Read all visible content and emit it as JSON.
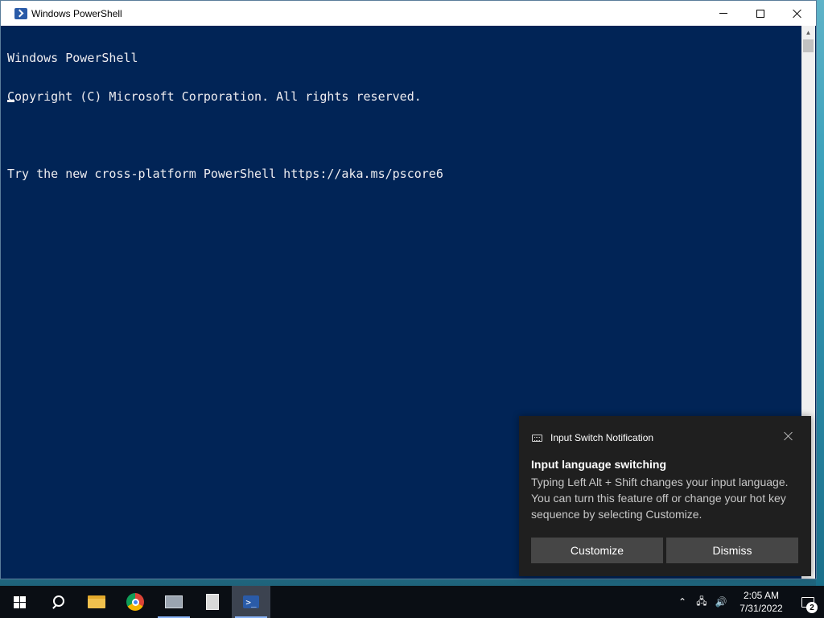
{
  "window": {
    "title": "Windows PowerShell"
  },
  "console": {
    "lines": [
      "Windows PowerShell",
      "Copyright (C) Microsoft Corporation. All rights reserved.",
      "",
      "Try the new cross-platform PowerShell https://aka.ms/pscore6"
    ]
  },
  "toast": {
    "app_name": "Input Switch Notification",
    "title": "Input language switching",
    "body": "Typing Left Alt + Shift changes your input language. You can turn this feature off or change your hot key sequence by selecting Customize.",
    "customize_label": "Customize",
    "dismiss_label": "Dismiss"
  },
  "taskbar": {
    "time": "2:05 AM",
    "date": "7/31/2022",
    "notification_count": "2",
    "pinned": [
      "start-icon",
      "search-icon",
      "file-explorer-icon",
      "chrome-icon",
      "server-manager-icon",
      "document-icon",
      "powershell-icon"
    ]
  },
  "colors": {
    "console_bg": "#012456",
    "console_fg": "#eeedf0",
    "taskbar_bg": "#0a0e14",
    "toast_bg": "#1f1f1f"
  }
}
